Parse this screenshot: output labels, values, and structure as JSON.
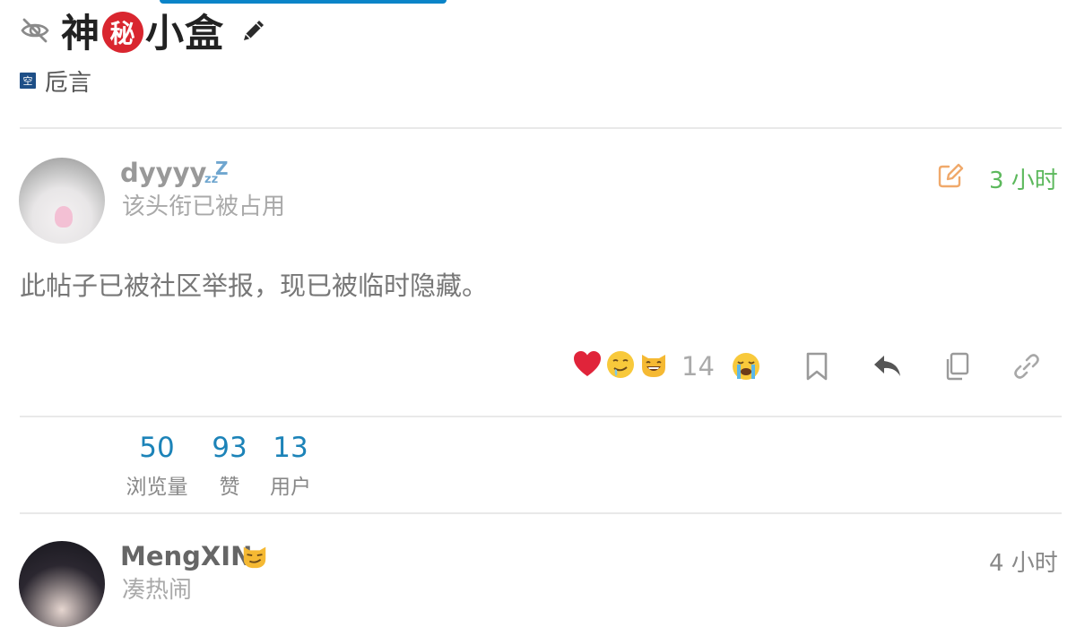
{
  "topic": {
    "title_before": "神",
    "title_badge": "秘",
    "title_after": "小盒",
    "category_badge": "空",
    "category": "卮言"
  },
  "post1": {
    "username": "dyyyy",
    "status_glyph": "zz",
    "status_glyph_big": "Z",
    "user_title": "该头衔已被占用",
    "time": "3 小时",
    "body": "此帖子已被社区举报，现已被临时隐藏。",
    "reaction_count": "14",
    "reactions": [
      "heart",
      "drooling-face",
      "grinning-cat"
    ],
    "my_reaction": "crying-face"
  },
  "summary": {
    "views": "50",
    "views_label": "浏览量",
    "likes": "93",
    "likes_label": "赞",
    "users": "13",
    "users_label": "用户"
  },
  "post2": {
    "username": "MengXIN",
    "user_title": "凑热闹",
    "time": "4 小时"
  },
  "colors": {
    "accent": "#1c83b8",
    "time_green": "#5cb85c",
    "edit_orange": "#f0a96b",
    "badge_red": "#d9262f",
    "category_blue": "#1e4f87"
  }
}
